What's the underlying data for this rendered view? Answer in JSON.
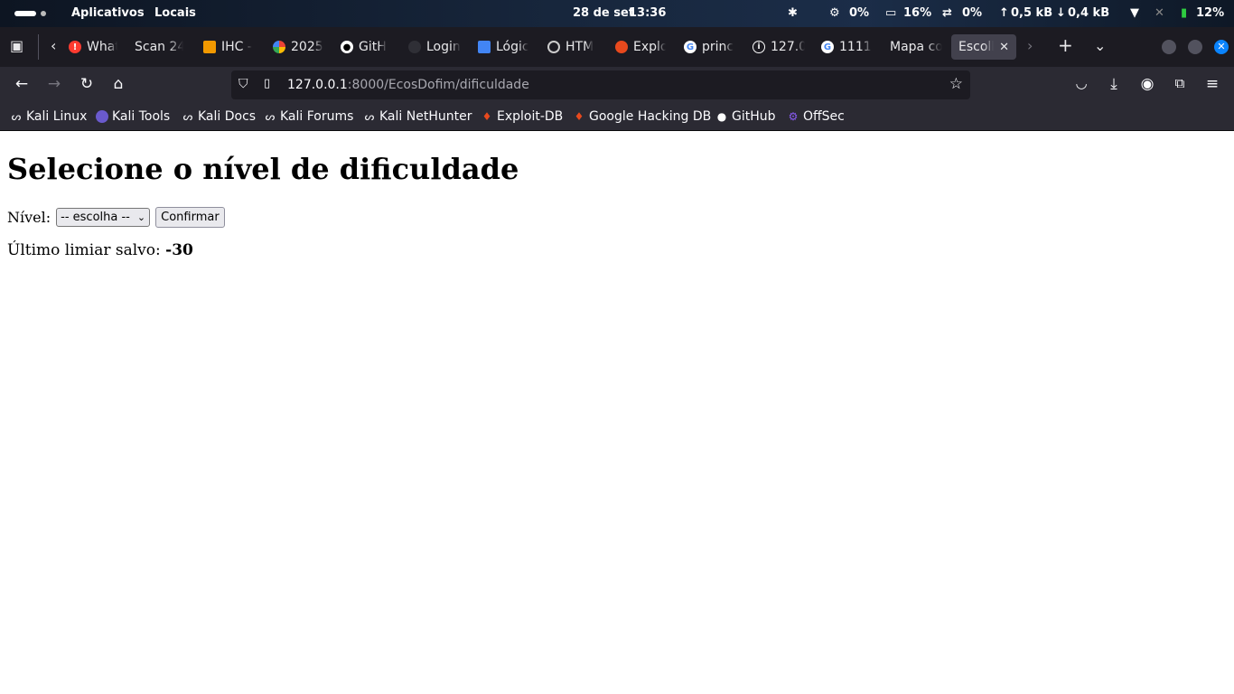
{
  "topbar": {
    "apps": "Aplicativos",
    "places": "Locais",
    "date": "28 de set",
    "time": "13:36",
    "cpu": "0%",
    "mem": "16%",
    "swap": "0%",
    "up": "0,5 kB",
    "down": "0,4 kB",
    "battery": "12%"
  },
  "tabs": [
    {
      "label": "What",
      "icon": "whatsapp-icon",
      "color": "#ff3b30"
    },
    {
      "label": "Scan 24",
      "icon": "",
      "color": ""
    },
    {
      "label": "IHC -",
      "icon": "slides-icon",
      "color": "#f29900"
    },
    {
      "label": "2025",
      "icon": "pinwheel-icon",
      "color": "#34a853"
    },
    {
      "label": "GitH",
      "icon": "github-icon",
      "color": "#ffffff"
    },
    {
      "label": "Login",
      "icon": "page-icon",
      "color": "#3a3a3a"
    },
    {
      "label": "Lógic",
      "icon": "classroom-icon",
      "color": "#4285f4"
    },
    {
      "label": "HTM",
      "icon": "openai-icon",
      "color": "#cccccc"
    },
    {
      "label": "Explo",
      "icon": "exploit-db-icon",
      "color": "#e8491d"
    },
    {
      "label": "princ",
      "icon": "google-icon",
      "color": "#ffffff"
    },
    {
      "label": "127.0",
      "icon": "info-icon",
      "color": "#ffffff"
    },
    {
      "label": "11111",
      "icon": "google-icon",
      "color": "#ffffff"
    },
    {
      "label": "Mapa co",
      "icon": "",
      "color": ""
    },
    {
      "label": "Escolh",
      "icon": "",
      "color": "",
      "active": true
    }
  ],
  "url": {
    "host": "127.0.0.1",
    "path": ":8000/EcosDofim/dificuldade"
  },
  "bookmarks": [
    {
      "label": "Kali Linux",
      "icon": "kali-dragon-icon"
    },
    {
      "label": "Kali Tools",
      "icon": "kali-tools-icon"
    },
    {
      "label": "Kali Docs",
      "icon": "kali-dragon-icon"
    },
    {
      "label": "Kali Forums",
      "icon": "kali-dragon-icon"
    },
    {
      "label": "Kali NetHunter",
      "icon": "kali-dragon-icon"
    },
    {
      "label": "Exploit-DB",
      "icon": "exploit-db-icon"
    },
    {
      "label": "Google Hacking DB",
      "icon": "exploit-db-icon"
    },
    {
      "label": "GitHub",
      "icon": "github-icon"
    },
    {
      "label": "OffSec",
      "icon": "offsec-icon"
    }
  ],
  "page": {
    "heading": "Selecione o nível de dificuldade",
    "level_label": "Nível:",
    "select_value": "-- escolha --",
    "confirm_label": "Confirmar",
    "saved_label": "Último limiar salvo:",
    "saved_value": "-30"
  }
}
